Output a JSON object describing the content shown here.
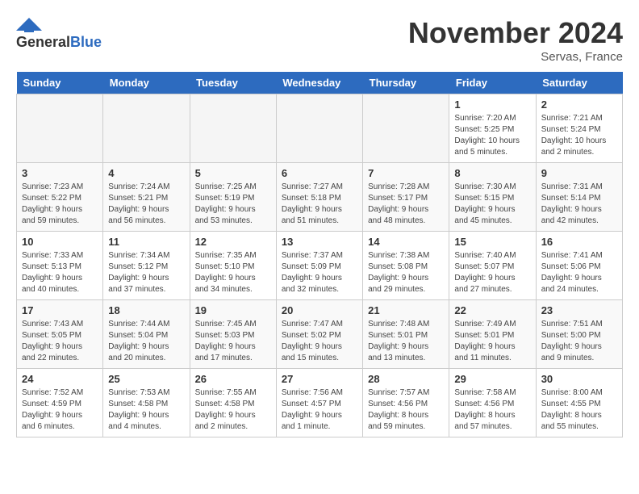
{
  "logo": {
    "general": "General",
    "blue": "Blue"
  },
  "title": "November 2024",
  "location": "Servas, France",
  "headers": [
    "Sunday",
    "Monday",
    "Tuesday",
    "Wednesday",
    "Thursday",
    "Friday",
    "Saturday"
  ],
  "weeks": [
    [
      {
        "day": "",
        "info": ""
      },
      {
        "day": "",
        "info": ""
      },
      {
        "day": "",
        "info": ""
      },
      {
        "day": "",
        "info": ""
      },
      {
        "day": "",
        "info": ""
      },
      {
        "day": "1",
        "info": "Sunrise: 7:20 AM\nSunset: 5:25 PM\nDaylight: 10 hours\nand 5 minutes."
      },
      {
        "day": "2",
        "info": "Sunrise: 7:21 AM\nSunset: 5:24 PM\nDaylight: 10 hours\nand 2 minutes."
      }
    ],
    [
      {
        "day": "3",
        "info": "Sunrise: 7:23 AM\nSunset: 5:22 PM\nDaylight: 9 hours\nand 59 minutes."
      },
      {
        "day": "4",
        "info": "Sunrise: 7:24 AM\nSunset: 5:21 PM\nDaylight: 9 hours\nand 56 minutes."
      },
      {
        "day": "5",
        "info": "Sunrise: 7:25 AM\nSunset: 5:19 PM\nDaylight: 9 hours\nand 53 minutes."
      },
      {
        "day": "6",
        "info": "Sunrise: 7:27 AM\nSunset: 5:18 PM\nDaylight: 9 hours\nand 51 minutes."
      },
      {
        "day": "7",
        "info": "Sunrise: 7:28 AM\nSunset: 5:17 PM\nDaylight: 9 hours\nand 48 minutes."
      },
      {
        "day": "8",
        "info": "Sunrise: 7:30 AM\nSunset: 5:15 PM\nDaylight: 9 hours\nand 45 minutes."
      },
      {
        "day": "9",
        "info": "Sunrise: 7:31 AM\nSunset: 5:14 PM\nDaylight: 9 hours\nand 42 minutes."
      }
    ],
    [
      {
        "day": "10",
        "info": "Sunrise: 7:33 AM\nSunset: 5:13 PM\nDaylight: 9 hours\nand 40 minutes."
      },
      {
        "day": "11",
        "info": "Sunrise: 7:34 AM\nSunset: 5:12 PM\nDaylight: 9 hours\nand 37 minutes."
      },
      {
        "day": "12",
        "info": "Sunrise: 7:35 AM\nSunset: 5:10 PM\nDaylight: 9 hours\nand 34 minutes."
      },
      {
        "day": "13",
        "info": "Sunrise: 7:37 AM\nSunset: 5:09 PM\nDaylight: 9 hours\nand 32 minutes."
      },
      {
        "day": "14",
        "info": "Sunrise: 7:38 AM\nSunset: 5:08 PM\nDaylight: 9 hours\nand 29 minutes."
      },
      {
        "day": "15",
        "info": "Sunrise: 7:40 AM\nSunset: 5:07 PM\nDaylight: 9 hours\nand 27 minutes."
      },
      {
        "day": "16",
        "info": "Sunrise: 7:41 AM\nSunset: 5:06 PM\nDaylight: 9 hours\nand 24 minutes."
      }
    ],
    [
      {
        "day": "17",
        "info": "Sunrise: 7:43 AM\nSunset: 5:05 PM\nDaylight: 9 hours\nand 22 minutes."
      },
      {
        "day": "18",
        "info": "Sunrise: 7:44 AM\nSunset: 5:04 PM\nDaylight: 9 hours\nand 20 minutes."
      },
      {
        "day": "19",
        "info": "Sunrise: 7:45 AM\nSunset: 5:03 PM\nDaylight: 9 hours\nand 17 minutes."
      },
      {
        "day": "20",
        "info": "Sunrise: 7:47 AM\nSunset: 5:02 PM\nDaylight: 9 hours\nand 15 minutes."
      },
      {
        "day": "21",
        "info": "Sunrise: 7:48 AM\nSunset: 5:01 PM\nDaylight: 9 hours\nand 13 minutes."
      },
      {
        "day": "22",
        "info": "Sunrise: 7:49 AM\nSunset: 5:01 PM\nDaylight: 9 hours\nand 11 minutes."
      },
      {
        "day": "23",
        "info": "Sunrise: 7:51 AM\nSunset: 5:00 PM\nDaylight: 9 hours\nand 9 minutes."
      }
    ],
    [
      {
        "day": "24",
        "info": "Sunrise: 7:52 AM\nSunset: 4:59 PM\nDaylight: 9 hours\nand 6 minutes."
      },
      {
        "day": "25",
        "info": "Sunrise: 7:53 AM\nSunset: 4:58 PM\nDaylight: 9 hours\nand 4 minutes."
      },
      {
        "day": "26",
        "info": "Sunrise: 7:55 AM\nSunset: 4:58 PM\nDaylight: 9 hours\nand 2 minutes."
      },
      {
        "day": "27",
        "info": "Sunrise: 7:56 AM\nSunset: 4:57 PM\nDaylight: 9 hours\nand 1 minute."
      },
      {
        "day": "28",
        "info": "Sunrise: 7:57 AM\nSunset: 4:56 PM\nDaylight: 8 hours\nand 59 minutes."
      },
      {
        "day": "29",
        "info": "Sunrise: 7:58 AM\nSunset: 4:56 PM\nDaylight: 8 hours\nand 57 minutes."
      },
      {
        "day": "30",
        "info": "Sunrise: 8:00 AM\nSunset: 4:55 PM\nDaylight: 8 hours\nand 55 minutes."
      }
    ]
  ]
}
